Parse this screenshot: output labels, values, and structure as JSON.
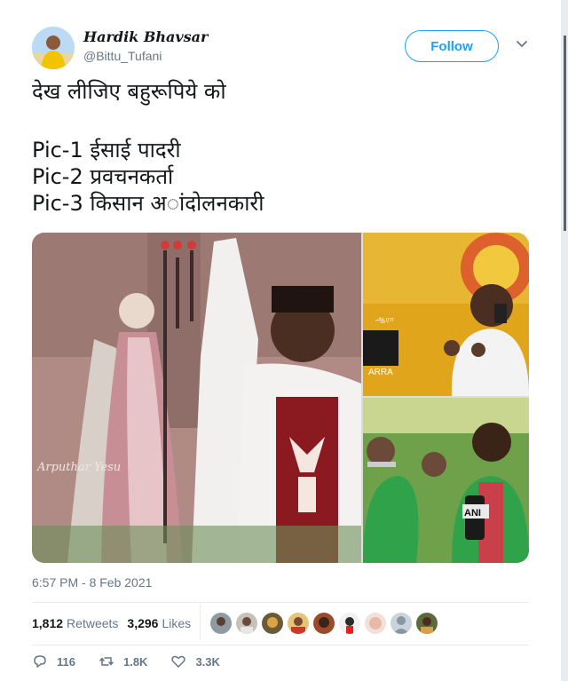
{
  "tweet": {
    "display_name": "Hardik Bhavsar",
    "handle": "@Bittu_Tufani",
    "follow_label": "Follow",
    "lines": [
      "देख लीजिए बहुरूपिये को",
      "Pic-1 ईसाई पादरी",
      "Pic-2 प्रवचनकर्ता",
      "Pic-3 किसान अांदोलनकारी"
    ],
    "timestamp": "6:57 PM - 8 Feb 2021"
  },
  "media": {
    "watermark_1": "Arputhar Yesu",
    "logo_2": "ARRA",
    "tag_2": "ஆரா",
    "logo_3": "ANI"
  },
  "stats": {
    "retweets_count": "1,812",
    "retweets_label": "Retweets",
    "likes_count": "3,296",
    "likes_label": "Likes"
  },
  "actions": {
    "replies": "116",
    "retweets": "1.8K",
    "likes": "3.3K"
  },
  "colors": {
    "accent": "#1da1f2",
    "secondary_text": "#657786",
    "divider": "#e6ecf0"
  }
}
